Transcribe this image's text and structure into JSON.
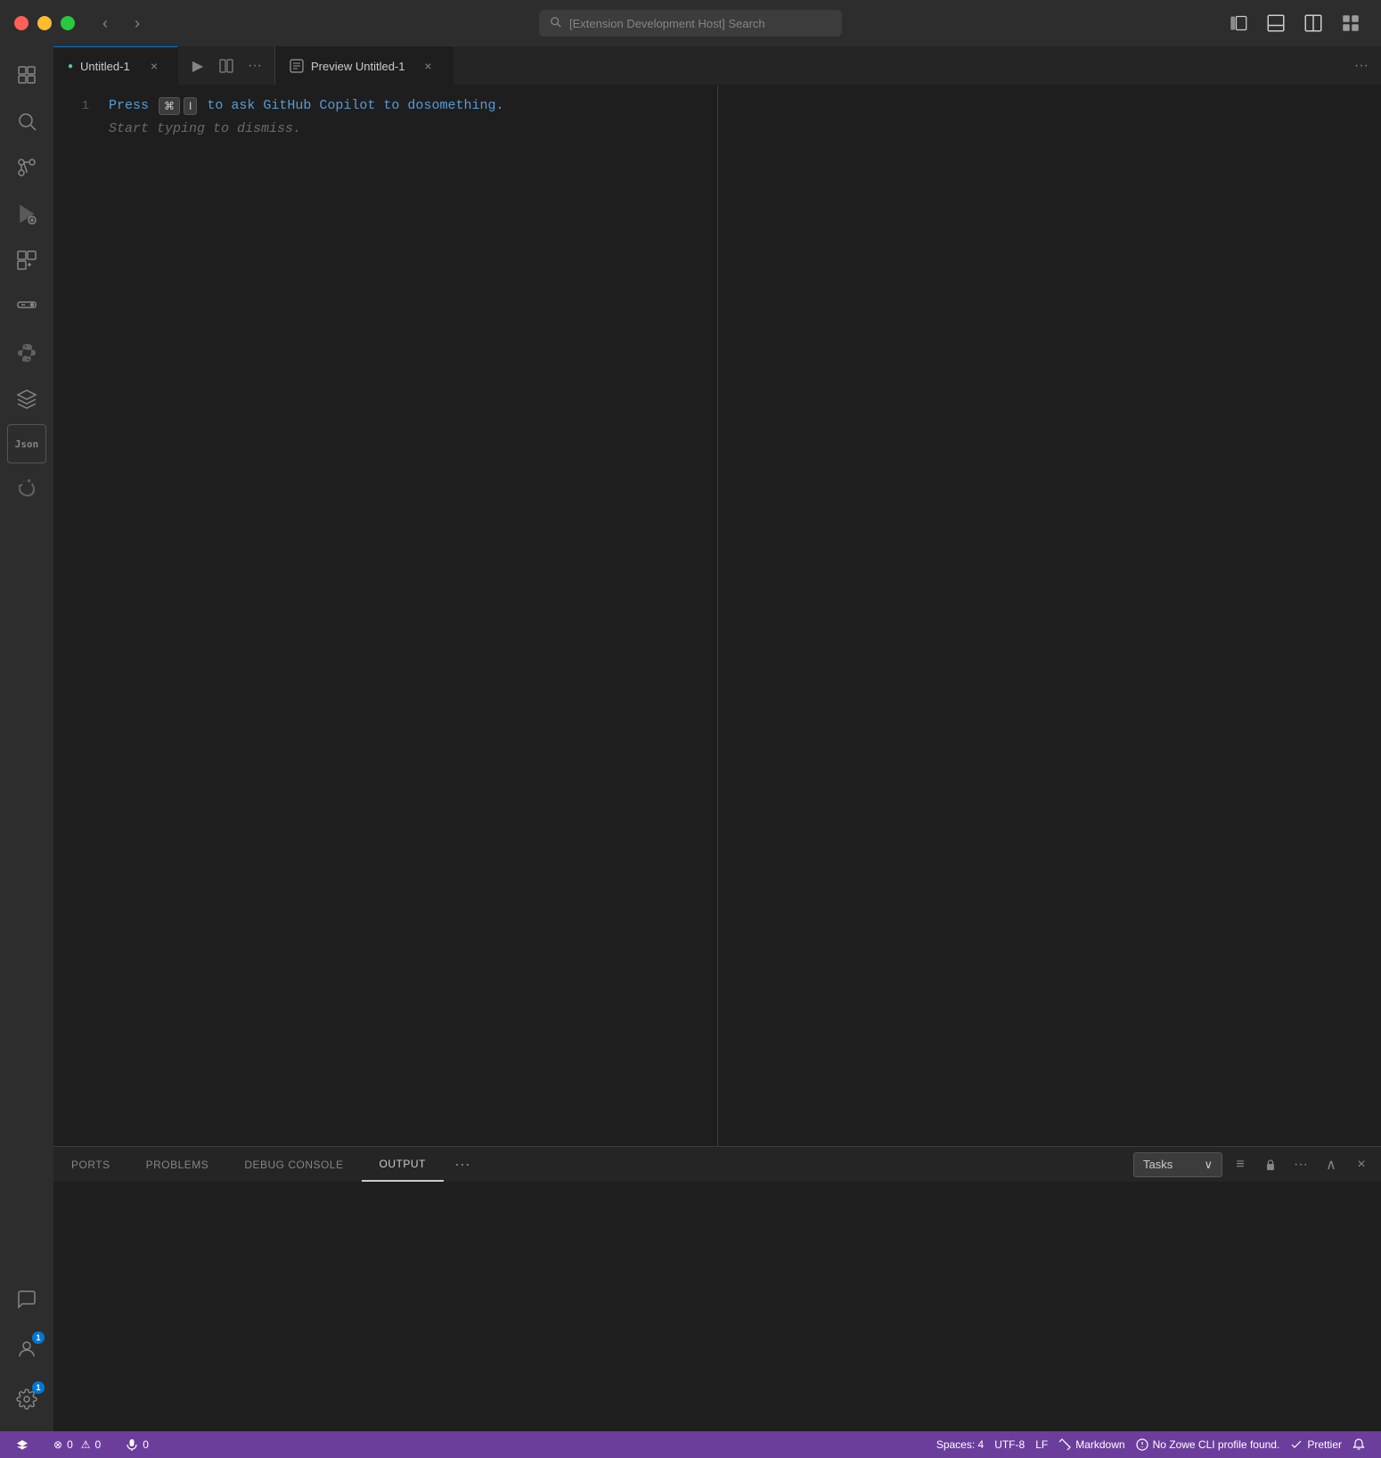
{
  "titlebar": {
    "search_placeholder": "[Extension Development Host] Search",
    "nav_back": "‹",
    "nav_forward": "›"
  },
  "tabs": {
    "left_tab": {
      "label": "Untitled-1",
      "close": "×",
      "dot_icon": "●"
    },
    "preview_tab": {
      "label": "Preview Untitled-1",
      "close": "×"
    }
  },
  "editor": {
    "line_number": "1",
    "line_content_press": "Press",
    "line_content_key1": "⌘",
    "line_content_key2": "I",
    "line_content_to": "to ask GitHub Copilot to do",
    "line_content_something": "something.",
    "line_content_ghost": "Start typing to dismiss."
  },
  "panel": {
    "tabs": [
      "PORTS",
      "PROBLEMS",
      "DEBUG CONSOLE",
      "OUTPUT"
    ],
    "active_tab": "OUTPUT",
    "more_label": "•••",
    "dropdown_label": "Tasks",
    "actions": {
      "list": "≡",
      "lock": "🔒",
      "more": "•••",
      "up": "∧",
      "close": "×"
    }
  },
  "statusbar": {
    "left_icon": "×",
    "errors": "0",
    "warnings": "0",
    "mic_icon": "🎤",
    "mic_count": "0",
    "spaces_label": "Spaces: 4",
    "encoding": "UTF-8",
    "eol": "LF",
    "language_icon": "🔧",
    "language": "Markdown",
    "zowe_icon": "⚡",
    "zowe_msg": "No Zowe CLI profile found.",
    "prettier_icon": "✓",
    "prettier": "Prettier",
    "bell_icon": "🔔",
    "badge_1": "1"
  },
  "activity": {
    "items": [
      {
        "name": "explorer",
        "icon": "files"
      },
      {
        "name": "search",
        "icon": "search"
      },
      {
        "name": "source-control",
        "icon": "git"
      },
      {
        "name": "run-debug",
        "icon": "run"
      },
      {
        "name": "extensions",
        "icon": "extensions"
      },
      {
        "name": "remote-explorer",
        "icon": "remote"
      },
      {
        "name": "python",
        "icon": "python"
      },
      {
        "name": "zowe",
        "icon": "zowe"
      },
      {
        "name": "json",
        "icon": "json"
      },
      {
        "name": "docker",
        "icon": "docker"
      },
      {
        "name": "chat",
        "icon": "chat"
      }
    ]
  }
}
